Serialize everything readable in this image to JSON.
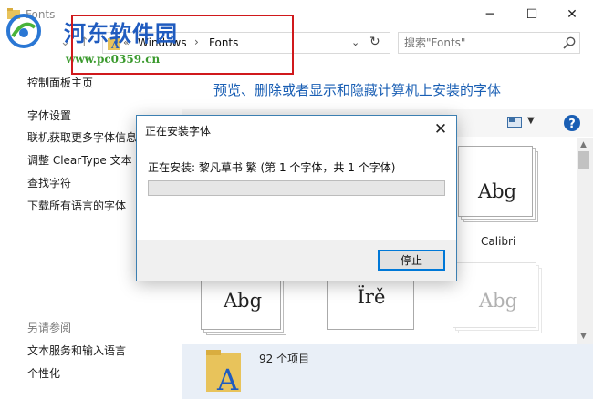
{
  "window": {
    "title": "Fonts",
    "controls": {
      "minimize": "─",
      "maximize": "☐",
      "close": "✕"
    }
  },
  "watermark": {
    "title": "河东软件园",
    "url": "www.pc0359.cn"
  },
  "address_bar": {
    "crumbs": [
      "Windows",
      "Fonts"
    ]
  },
  "search": {
    "placeholder": "搜索\"Fonts\""
  },
  "left_panel": {
    "home": "控制面板主页",
    "links": [
      "字体设置",
      "联机获取更多字体信息",
      "调整 ClearType 文本",
      "查找字符",
      "下载所有语言的字体"
    ],
    "see_also_title": "另请参阅",
    "see_also": [
      "文本服务和输入语言",
      "个性化"
    ]
  },
  "main": {
    "heading": "预览、删除或者显示和隐藏计算机上安装的字体",
    "fonts": [
      {
        "sample": "Abg",
        "name": "Calibri"
      },
      {
        "sample": "Abg",
        "name": ""
      },
      {
        "sample": "Ïrě",
        "name": ""
      },
      {
        "sample": "Abg",
        "name": ""
      }
    ]
  },
  "details": {
    "item_count": "92 个项目"
  },
  "dialog": {
    "title": "正在安装字体",
    "status": "正在安装: 黎凡草书 繁 (第 1 个字体，共 1 个字体)",
    "progress_percent": 0,
    "stop_button": "停止",
    "close": "✕"
  },
  "colors": {
    "accent_blue": "#1a5fb4",
    "highlight_red": "#d0191c",
    "details_bg": "#e9eff7",
    "progress_fill": "#06b025"
  }
}
